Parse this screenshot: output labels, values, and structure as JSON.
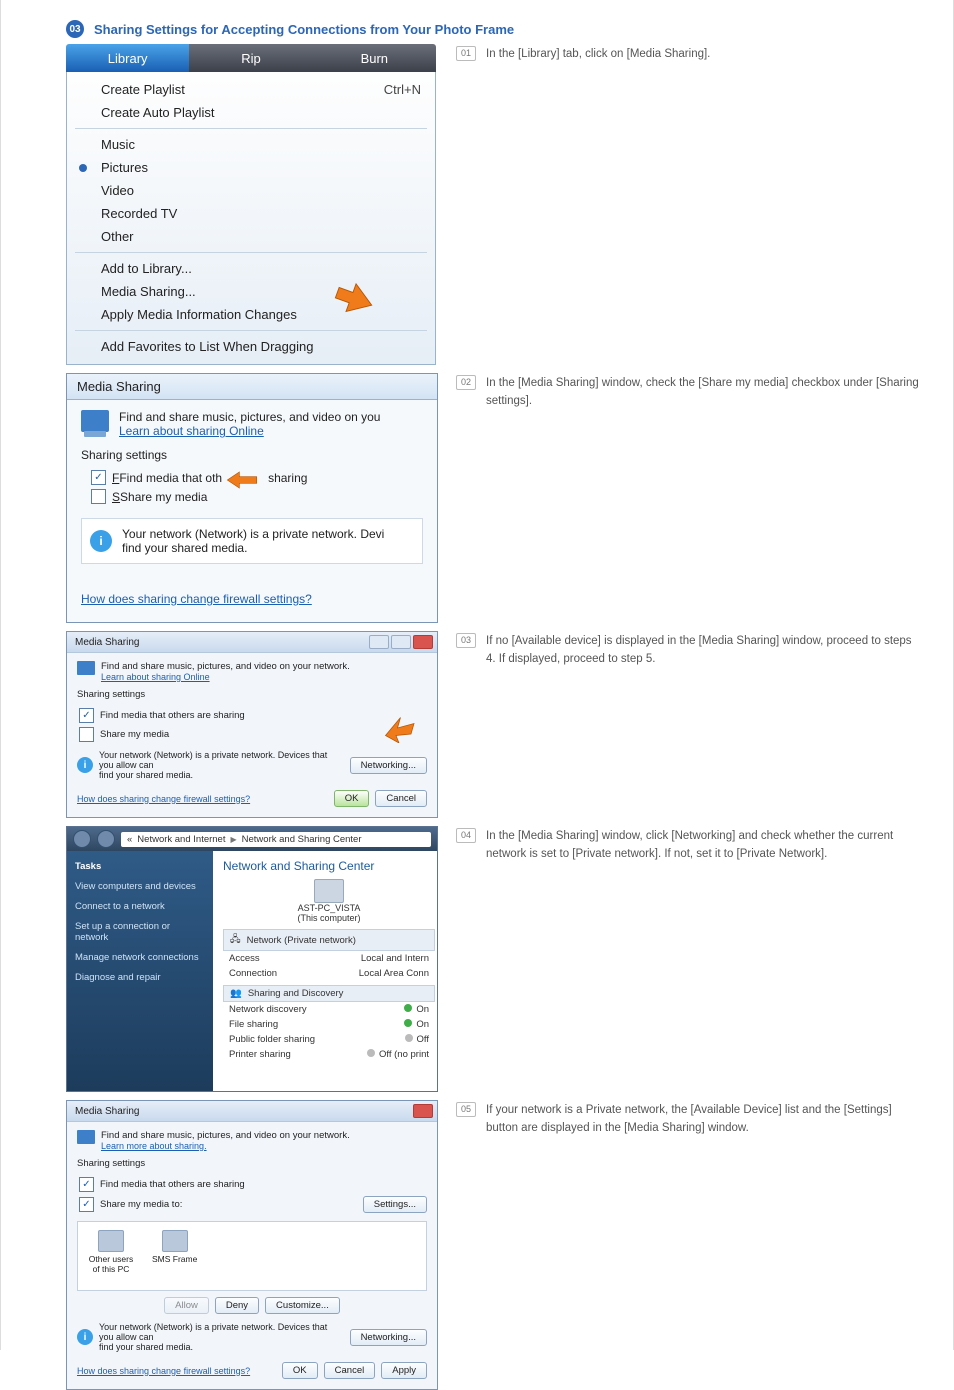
{
  "section": {
    "badge": "03",
    "title": "Sharing Settings for Accepting Connections from Your Photo Frame"
  },
  "steps": {
    "s1": {
      "no": "01",
      "text": "In the [Library] tab, click on [Media Sharing]."
    },
    "s2": {
      "no": "02",
      "text": "In the [Media Sharing] window, check the [Share my media] checkbox under [Sharing settings]."
    },
    "s3": {
      "no": "03",
      "text": "If no [Available device] is displayed in the [Media Sharing] window, proceed to steps 4. If displayed, proceed to step 5."
    },
    "s4": {
      "no": "04",
      "text": "In the [Media Sharing] window, click [Networking] and check whether the current network is set to [Private network]. If not, set it to [Private Network]."
    },
    "s5": {
      "no": "05",
      "text": "If your network is a Private network, the [Available Device] list and the [Settings] button are displayed in the [Media Sharing] window."
    }
  },
  "wmp": {
    "tabs": {
      "library": "Library",
      "rip": "Rip",
      "burn": "Burn"
    },
    "items": {
      "create_pl": "Create Playlist",
      "create_pl_sc": "Ctrl+N",
      "create_auto": "Create Auto Playlist",
      "music": "Music",
      "pictures": "Pictures",
      "video": "Video",
      "recorded": "Recorded TV",
      "other": "Other",
      "add_to_lib": "Add to Library...",
      "media_sharing": "Media Sharing...",
      "apply_info": "Apply Media Information Changes",
      "add_fav": "Add Favorites to List When Dragging"
    }
  },
  "dlg2": {
    "title": "Media Sharing",
    "intro": "Find and share music, pictures, and video on you",
    "learn": "Learn about sharing Online",
    "settings_hd": "Sharing settings",
    "cb_find": "Find media that oth",
    "cb_find_tail": "sharing",
    "cb_share": "Share my media",
    "info": "Your network (Network) is a private network. Devi",
    "info2": "find your shared media.",
    "link": "How does sharing change firewall settings?"
  },
  "mini": {
    "title": "Media Sharing",
    "intro": "Find and share music, pictures, and video on your network.",
    "learn": "Learn about sharing Online",
    "settings_hd": "Sharing settings",
    "cb_find": "Find media that others are sharing",
    "cb_share": "Share my media",
    "info": "Your network (Network) is a private network. Devices that you allow can",
    "info2": "find your shared media.",
    "btn_net": "Networking...",
    "link": "How does sharing change firewall settings?",
    "ok": "OK",
    "cancel": "Cancel"
  },
  "net": {
    "crumb_a": "Network and Internet",
    "crumb_b": "Network and Sharing Center",
    "side": {
      "hd": "Tasks",
      "a": "View computers and devices",
      "b": "Connect to a network",
      "c": "Set up a connection or network",
      "d": "Manage network connections",
      "e": "Diagnose and repair"
    },
    "title": "Network and Sharing Center",
    "pc_name": "AST-PC_VISTA",
    "pc_sub": "(This computer)",
    "grp_net": "Network (Private network)",
    "kv": {
      "access": "Access",
      "access_v": "Local and Intern",
      "conn": "Connection",
      "conn_v": "Local Area Conn"
    },
    "grp_sd": "Sharing and Discovery",
    "sd": {
      "a": "Network discovery",
      "av": "On",
      "b": "File sharing",
      "bv": "On",
      "c": "Public folder sharing",
      "cv": "Off",
      "d": "Printer sharing",
      "dv": "Off (no print"
    }
  },
  "mini5": {
    "learn": "Learn more about sharing.",
    "cb_share": "Share my media to:",
    "btn_settings": "Settings...",
    "dev_a": "Other users of this PC",
    "dev_b": "SMS Frame",
    "allow": "Allow",
    "deny": "Deny",
    "custom": "Customize...",
    "apply": "Apply"
  }
}
